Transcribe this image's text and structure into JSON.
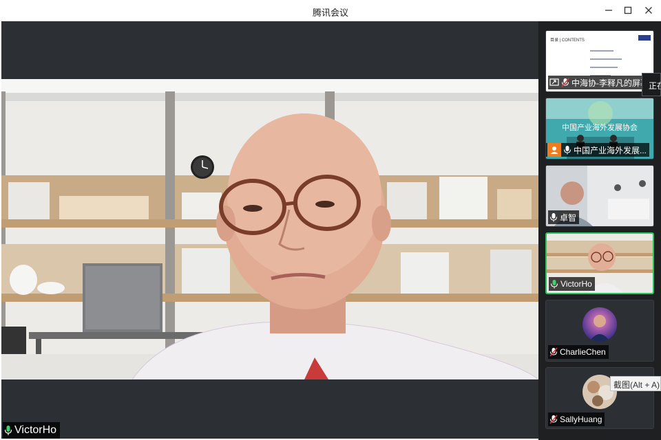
{
  "window": {
    "title": "腾讯会议",
    "minimize_icon": "minimize-icon",
    "maximize_icon": "maximize-icon",
    "close_icon": "close-icon"
  },
  "main_video": {
    "speaker": "VictorHo",
    "mic_state": "on"
  },
  "participants": [
    {
      "name": "中海协-李释凡的屏幕",
      "kind": "screen-share",
      "mic_state": "muted",
      "slide_heading": "目录 | CONTENTS"
    },
    {
      "name": "中国产业海外发展...",
      "kind": "video",
      "mic_state": "on",
      "banner_text": "中国产业海外发展协会"
    },
    {
      "name": "卓智",
      "kind": "video",
      "mic_state": "on"
    },
    {
      "name": "VictorHo",
      "kind": "video",
      "mic_state": "on",
      "active_speaker": true
    },
    {
      "name": "CharlieChen",
      "kind": "avatar",
      "mic_state": "muted"
    },
    {
      "name": "SallyHuang",
      "kind": "avatar",
      "mic_state": "muted"
    }
  ],
  "tooltips": {
    "speaking": "正在",
    "screenshot": "截图(Alt + A)"
  },
  "colors": {
    "active_border": "#27c35a",
    "mute_red": "#e0393e",
    "panel_bg": "#1e2022",
    "stage_bg": "#2c2f33"
  }
}
